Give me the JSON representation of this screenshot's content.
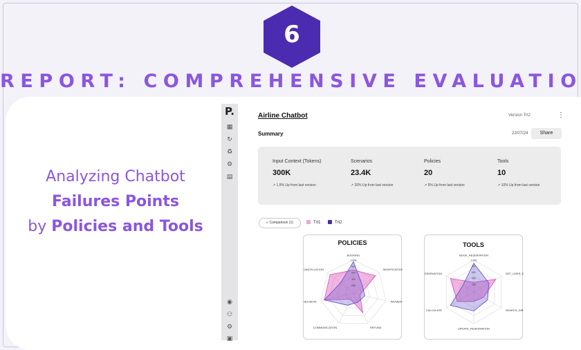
{
  "badge": {
    "number": "6",
    "color": "#4b2bb0"
  },
  "title": "REPORT: COMPREHENSIVE EVALUATION",
  "tagline": {
    "line1": "Analyzing Chatbot",
    "line2": "Failures Points",
    "line3_prefix": "by ",
    "line3_bold": "Policies and Tools"
  },
  "colors": {
    "accent": "#8b56e0",
    "trial1": "#e05cc0",
    "trial2": "#5a48c8"
  },
  "app": {
    "logo": "P.",
    "rail_icons": [
      "chart-icon",
      "refresh-icon",
      "recycle-icon",
      "settings-gear-icon",
      "clipboard-icon",
      "bell-icon",
      "users-icon",
      "gear-icon",
      "folder-icon"
    ],
    "header_title": "Airline Chatbot",
    "version": "Version Trt2",
    "summary_label": "Summary",
    "date": "22/07/24",
    "share_label": "Share",
    "stats": [
      {
        "label": "Input Context (Tokens)",
        "value": "300K",
        "change": "1.5% Up from last version"
      },
      {
        "label": "Scenarios",
        "value": "23.4K",
        "change": "20% Up from last version"
      },
      {
        "label": "Policies",
        "value": "20",
        "change": "5% Up from last version"
      },
      {
        "label": "Tools",
        "value": "10",
        "change": "10% Up from last version"
      }
    ],
    "compare_label": "Comparison (1)",
    "legend": [
      "Trt1",
      "Trt2"
    ]
  },
  "chart_data": [
    {
      "type": "radar",
      "title": "POLICIES",
      "axes": [
        "BOOKING",
        "MODIFICATION",
        "PAYMENT METHODS",
        "REFUND",
        "COMMUNICATION",
        "PRECISION",
        "CANCELLATION"
      ],
      "ticks": [
        "1,000",
        "800",
        "600",
        "400",
        "250"
      ],
      "range": [
        0,
        1000
      ],
      "series": [
        {
          "name": "Trt1",
          "values": [
            700,
            850,
            200,
            650,
            200,
            900,
            900
          ]
        },
        {
          "name": "Trt2",
          "values": [
            950,
            350,
            350,
            300,
            400,
            900,
            500
          ]
        }
      ]
    },
    {
      "type": "radar",
      "title": "TOOLS",
      "axes": [
        "BOOK_RESERVATION",
        "GET_USER_DETAILS",
        "SEARCH_DIRECT_FLIGHT",
        "UPDATE_RESERVATION",
        "CALCULATE",
        "CANCEL_RESERVATION"
      ],
      "ticks": [
        "1,000",
        "800",
        "600",
        "400",
        "250"
      ],
      "range": [
        0,
        1000
      ],
      "series": [
        {
          "name": "Trt1",
          "values": [
            300,
            800,
            350,
            300,
            600,
            850
          ]
        },
        {
          "name": "Trt2",
          "values": [
            900,
            550,
            500,
            600,
            850,
            400
          ]
        }
      ]
    }
  ]
}
